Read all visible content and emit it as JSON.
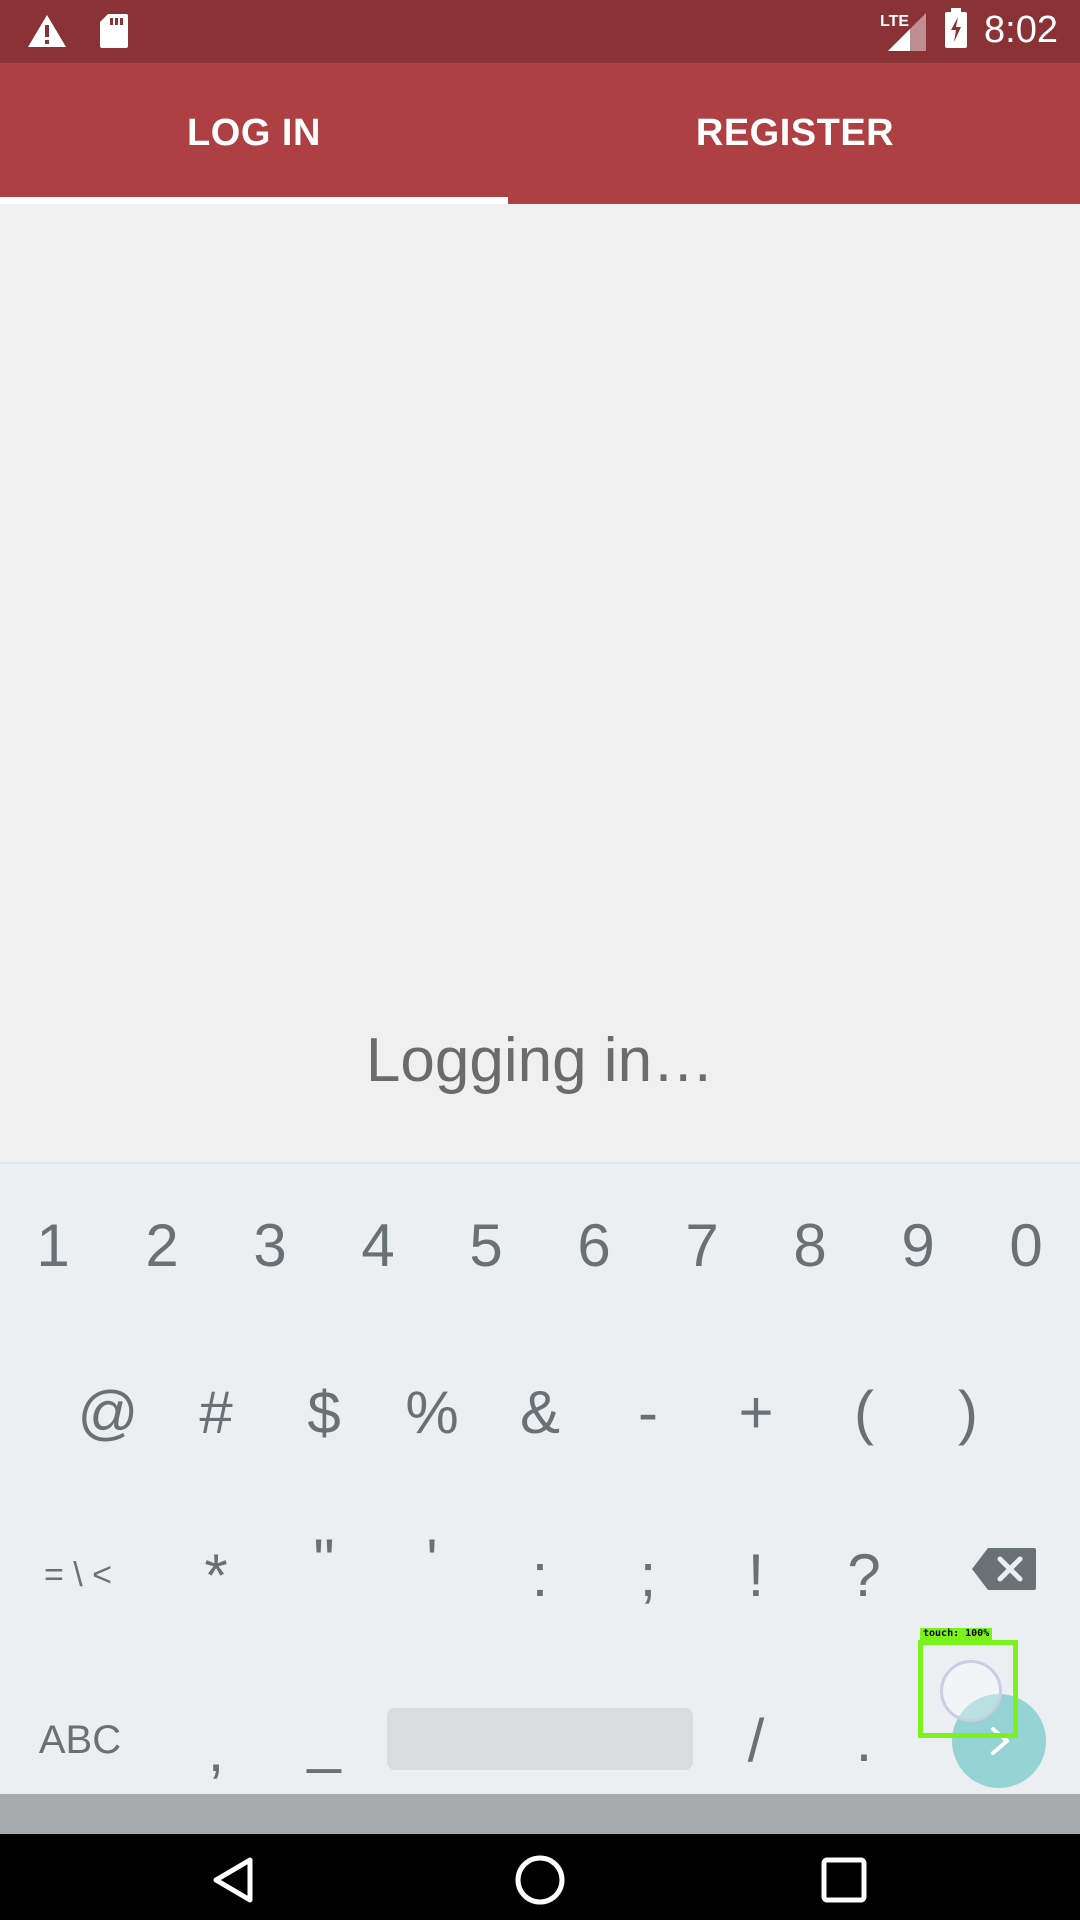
{
  "status_bar": {
    "time": "8:02",
    "network": "LTE",
    "icons": [
      "warning-icon",
      "sd-card-icon",
      "lte-signal-icon",
      "battery-charging-icon"
    ]
  },
  "tabs": [
    {
      "label": "LOG IN",
      "selected": true
    },
    {
      "label": "REGISTER",
      "selected": false
    }
  ],
  "main": {
    "status_text": "Logging in…"
  },
  "keyboard": {
    "row1": [
      "1",
      "2",
      "3",
      "4",
      "5",
      "6",
      "7",
      "8",
      "9",
      "0"
    ],
    "row2": [
      "@",
      "#",
      "$",
      "%",
      "&",
      "-",
      "+",
      "(",
      ")"
    ],
    "row3": [
      "= \\ <",
      "*",
      "\"",
      "'",
      ":",
      ";",
      "!",
      "?"
    ],
    "row4": {
      "abc": "ABC",
      "comma": ",",
      "underscore": "_",
      "slash": "/",
      "period": "."
    }
  },
  "overlay": {
    "touch_label": "touch: 100%"
  },
  "colors": {
    "statusbar": "#8a3236",
    "tabbar": "#ae4043",
    "keyboard_bg": "#eceff1",
    "enter_button": "#8ccfd0",
    "touch_box": "#7cf21c"
  }
}
